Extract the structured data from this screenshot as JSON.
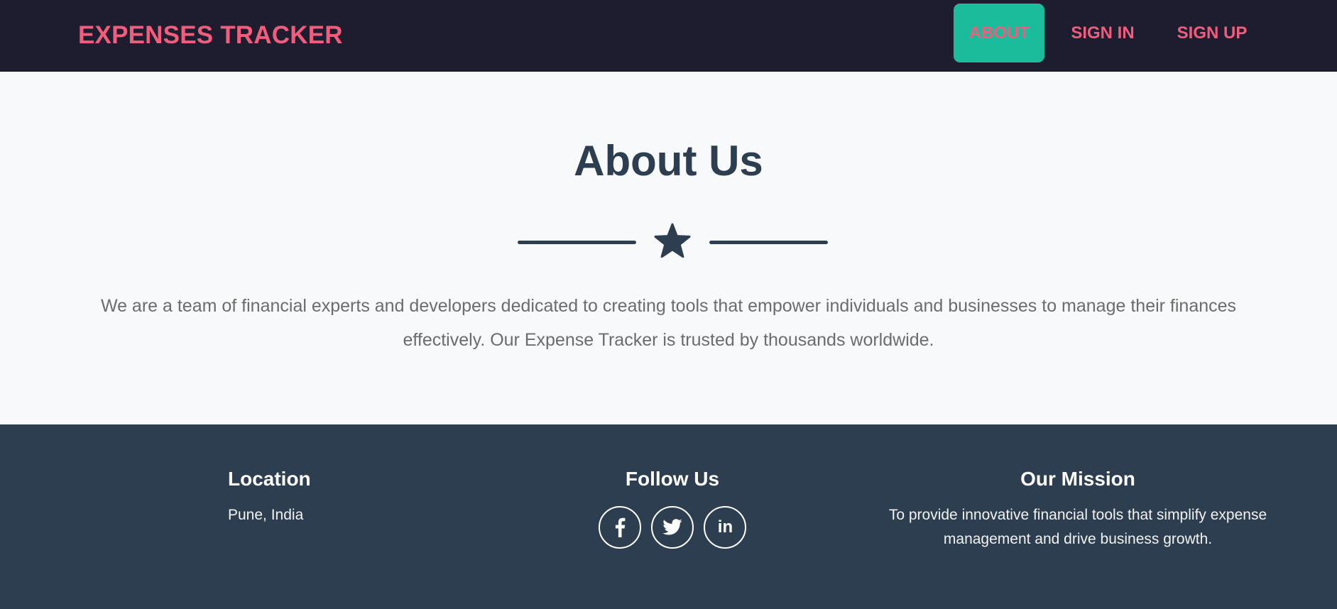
{
  "navbar": {
    "brand": "EXPENSES TRACKER",
    "links": [
      {
        "label": "ABOUT",
        "active": true
      },
      {
        "label": "SIGN IN",
        "active": false
      },
      {
        "label": "SIGN UP",
        "active": false
      }
    ]
  },
  "about": {
    "title": "About Us",
    "divider_icon": "star-icon",
    "description": "We are a team of financial experts and developers dedicated to creating tools that empower individuals and businesses to manage their finances effectively. Our Expense Tracker is trusted by thousands worldwide."
  },
  "footer": {
    "location": {
      "heading": "Location",
      "text": "Pune, India"
    },
    "follow": {
      "heading": "Follow Us",
      "icons": [
        "facebook-icon",
        "twitter-icon",
        "linkedin-icon"
      ],
      "linkedin_text": "in"
    },
    "mission": {
      "heading": "Our Mission",
      "text": "To provide innovative financial tools that simplify expense management and drive business growth."
    }
  },
  "colors": {
    "navbar_bg": "#1e1d2f",
    "brand": "#f15d7c",
    "active_link_bg": "#1abc9c",
    "heading": "#2c3e50",
    "footer_bg": "#2c3e50",
    "page_bg": "#f8f9fa"
  }
}
